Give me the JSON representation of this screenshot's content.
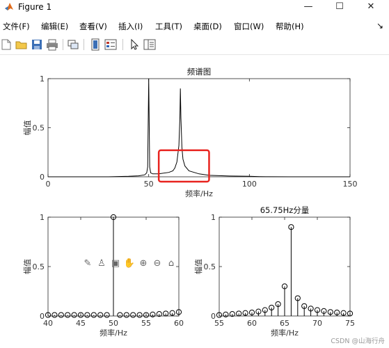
{
  "window": {
    "title": "Figure 1",
    "minimize": "—",
    "maximize": "☐",
    "close": "✕"
  },
  "menu": {
    "items": [
      "文件(F)",
      "编辑(E)",
      "查看(V)",
      "插入(I)",
      "工具(T)",
      "桌面(D)",
      "窗口(W)",
      "帮助(H)"
    ],
    "overflow": "↘"
  },
  "toolbar": {
    "icons": [
      "new-file-icon",
      "open-folder-icon",
      "save-icon",
      "print-icon",
      "link-figure-icon",
      "colorbar-icon",
      "legend-icon",
      "pointer-icon",
      "property-editor-icon"
    ]
  },
  "axes_toolbar": {
    "icons": [
      "brush-icon",
      "data-tips-icon",
      "export-icon",
      "pan-icon",
      "zoom-in-icon",
      "zoom-out-icon",
      "home-icon"
    ],
    "glyphs": [
      "✎",
      "♙",
      "▣",
      "✋",
      "⊕",
      "⊖",
      "⌂"
    ]
  },
  "highlight_color": "#e8231f",
  "watermark": "CSDN @山海行舟",
  "chart_data": [
    {
      "type": "line",
      "title": "频谱图",
      "xlabel": "频率/Hz",
      "ylabel": "幅值",
      "xlim": [
        0,
        150
      ],
      "ylim": [
        0,
        1
      ],
      "xticks": [
        0,
        50,
        100,
        150
      ],
      "yticks": [
        0,
        0.5,
        1
      ],
      "x": [
        0,
        30,
        40,
        45,
        48,
        49,
        49.5,
        50,
        50.5,
        51,
        52,
        55,
        60,
        62,
        63,
        64,
        65,
        65.5,
        65.75,
        66,
        66.5,
        67,
        68,
        70,
        75,
        80,
        90,
        100,
        105,
        110,
        120,
        150
      ],
      "y": [
        0,
        0,
        0.005,
        0.01,
        0.02,
        0.04,
        0.1,
        1.0,
        0.1,
        0.04,
        0.03,
        0.03,
        0.045,
        0.06,
        0.09,
        0.15,
        0.32,
        0.6,
        0.9,
        0.6,
        0.3,
        0.18,
        0.11,
        0.06,
        0.03,
        0.015,
        0.008,
        0.005,
        0.002,
        0.001,
        0,
        0
      ],
      "highlight_box": {
        "x": [
          55,
          80
        ],
        "y": [
          -0.05,
          0.27
        ]
      }
    },
    {
      "type": "stem",
      "title": "",
      "xlabel": "频率/Hz",
      "ylabel": "幅值",
      "xlim": [
        40,
        60
      ],
      "ylim": [
        0,
        1
      ],
      "xticks": [
        40,
        45,
        50,
        55,
        60
      ],
      "yticks": [
        0,
        0.5,
        1
      ],
      "x": [
        40,
        41,
        42,
        43,
        44,
        45,
        46,
        47,
        48,
        49,
        50,
        51,
        52,
        53,
        54,
        55,
        56,
        57,
        58,
        59,
        60
      ],
      "y": [
        0.01,
        0.01,
        0.01,
        0.01,
        0.01,
        0.01,
        0.01,
        0.01,
        0.01,
        0.01,
        1.0,
        0.01,
        0.01,
        0.01,
        0.01,
        0.01,
        0.015,
        0.02,
        0.025,
        0.03,
        0.04
      ]
    },
    {
      "type": "stem",
      "title": "65.75Hz分量",
      "xlabel": "频率/Hz",
      "ylabel": "幅值",
      "xlim": [
        55,
        75
      ],
      "ylim": [
        0,
        1
      ],
      "xticks": [
        55,
        60,
        65,
        70,
        75
      ],
      "yticks": [
        0,
        0.5,
        1
      ],
      "x": [
        55,
        56,
        57,
        58,
        59,
        60,
        61,
        62,
        63,
        64,
        65,
        66,
        67,
        68,
        69,
        70,
        71,
        72,
        73,
        74,
        75
      ],
      "y": [
        0.01,
        0.015,
        0.02,
        0.025,
        0.03,
        0.035,
        0.045,
        0.06,
        0.085,
        0.12,
        0.3,
        0.9,
        0.18,
        0.1,
        0.075,
        0.06,
        0.05,
        0.04,
        0.035,
        0.03,
        0.025
      ]
    }
  ]
}
